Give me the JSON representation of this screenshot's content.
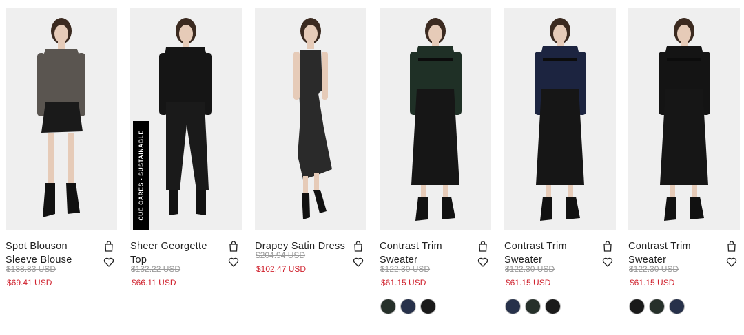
{
  "products": [
    {
      "name": "Spot Blouson Sleeve Blouse",
      "old_price": "$138.83 USD",
      "new_price": "$69.41 USD",
      "badge": "",
      "swatches": [],
      "figure": {
        "top": "#5a5550",
        "bottom": "#1a1a1a",
        "style": "skirt"
      }
    },
    {
      "name": "Sheer Georgette Top",
      "old_price": "$132.22 USD",
      "new_price": "$66.11 USD",
      "badge": "CUE CARES - SUSTAINABLE",
      "swatches": [],
      "figure": {
        "top": "#151515",
        "bottom": "#1a1a1a",
        "style": "pants"
      }
    },
    {
      "name": "Drapey Satin Dress",
      "old_price": "$204.94 USD",
      "new_price": "$102.47 USD",
      "badge": "",
      "swatches": [],
      "figure": {
        "top": "#2a2a2a",
        "bottom": "#2a2a2a",
        "style": "dress"
      }
    },
    {
      "name": "Contrast Trim Sweater",
      "old_price": "$122.30 USD",
      "new_price": "$61.15 USD",
      "badge": "",
      "swatches": [
        "#26302a",
        "#27314a",
        "#1a1a1a"
      ],
      "figure": {
        "top": "#1f3026",
        "bottom": "#161616",
        "style": "long"
      }
    },
    {
      "name": "Contrast Trim Sweater",
      "old_price": "$122.30 USD",
      "new_price": "$61.15 USD",
      "badge": "",
      "swatches": [
        "#27314a",
        "#26302a",
        "#1a1a1a"
      ],
      "figure": {
        "top": "#1c2440",
        "bottom": "#161616",
        "style": "long"
      }
    },
    {
      "name": "Contrast Trim Sweater",
      "old_price": "$122.30 USD",
      "new_price": "$61.15 USD",
      "badge": "",
      "swatches": [
        "#1a1a1a",
        "#26302a",
        "#27314a"
      ],
      "figure": {
        "top": "#141414",
        "bottom": "#161616",
        "style": "long"
      }
    }
  ],
  "icons": {
    "bag": "shopping-bag-icon",
    "wishlist": "heart-icon"
  }
}
